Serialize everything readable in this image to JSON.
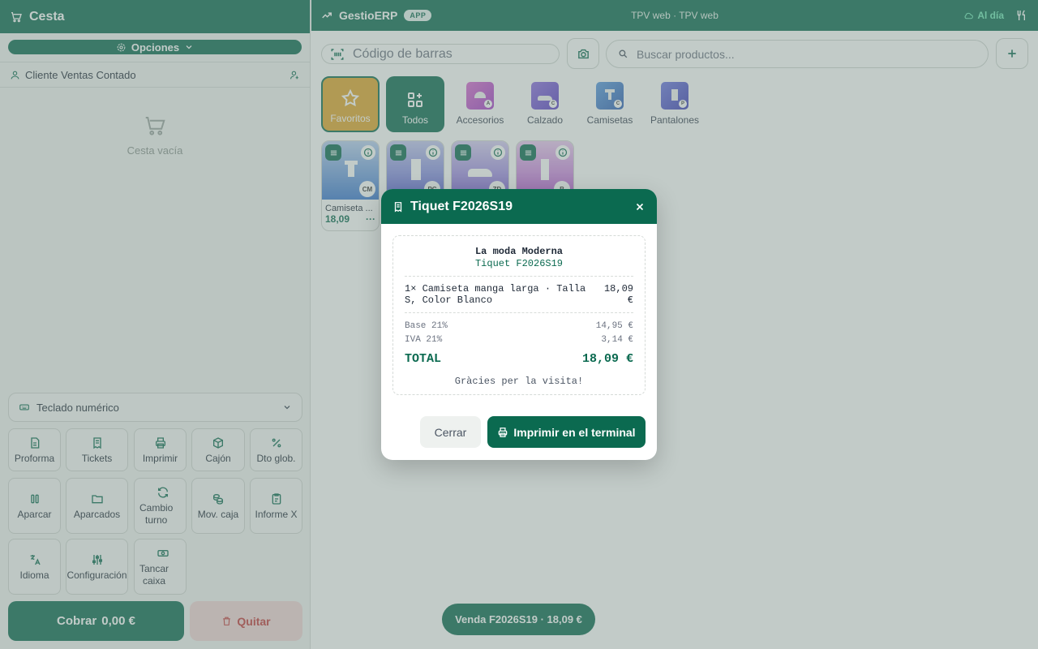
{
  "cart": {
    "title": "Cesta",
    "options_label": "Opciones",
    "client": "Cliente Ventas Contado",
    "empty_text": "Cesta vacía",
    "numpad_label": "Teclado numérico",
    "buttons": {
      "proforma": "Proforma",
      "tickets": "Tickets",
      "imprimir": "Imprimir",
      "cajon": "Cajón",
      "dto": "Dto glob.",
      "aparcar": "Aparcar",
      "aparcados": "Aparcados",
      "cambio_1": "Cambio",
      "cambio_2": "turno",
      "mov": "Mov. caja",
      "informe": "Informe X",
      "idioma": "Idioma",
      "config": "Configuración",
      "tancar_1": "Tancar",
      "tancar_2": "caixa"
    },
    "cobrar_label": "Cobrar",
    "cobrar_amount": "0,00 €",
    "quitar_label": "Quitar"
  },
  "topbar": {
    "brand": "GestioERP",
    "badge": "APP",
    "center": "TPV web · TPV web",
    "sync_status": "Al día"
  },
  "search": {
    "barcode_placeholder": "Código de barras",
    "product_placeholder": "Buscar productos..."
  },
  "categories": [
    {
      "label": "Favoritos",
      "icon": "star-icon"
    },
    {
      "label": "Todos",
      "icon": "grid-plus-icon"
    },
    {
      "label": "Accesorios",
      "tag": "A",
      "color": "#c84fc0"
    },
    {
      "label": "Calzado",
      "tag": "C",
      "color": "#7b5fd6"
    },
    {
      "label": "Camisetas",
      "tag": "C",
      "color": "#3f7fd1"
    },
    {
      "label": "Pantalones",
      "tag": "P",
      "color": "#5b62d0"
    }
  ],
  "products": [
    {
      "code": "CM",
      "name": "Camiseta ...",
      "price": "18,09"
    },
    {
      "code": "PC"
    },
    {
      "code": "ZD"
    },
    {
      "code": "B"
    }
  ],
  "venda_pill": "Venda F2026S19 · 18,09 €",
  "modal": {
    "title": "Tiquet F2026S19",
    "store": "La moda Moderna",
    "ticket": "Tiquet F2026S19",
    "line_desc": "1× Camiseta manga larga · Talla S, Color Blanco",
    "line_price": "18,09 €",
    "base_label": "Base 21%",
    "base_value": "14,95 €",
    "iva_label": "IVA 21%",
    "iva_value": "3,14 €",
    "total_label": "TOTAL",
    "total_value": "18,09 €",
    "thanks": "Gràcies per la visita!",
    "cerrar": "Cerrar",
    "print": "Imprimir en el terminal"
  },
  "colors": {
    "primary": "#0b6a50",
    "favorite": "#e0a62c",
    "danger": "#c23a3a"
  }
}
